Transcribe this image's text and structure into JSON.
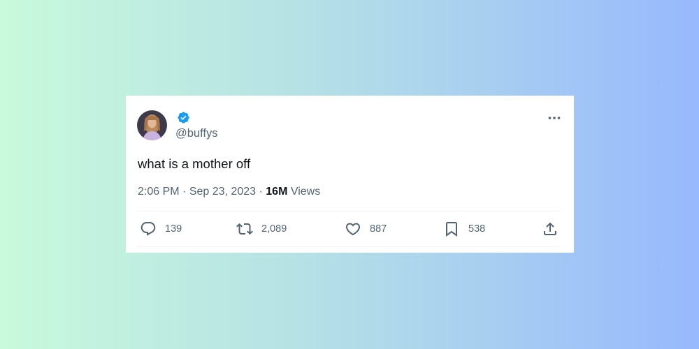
{
  "tweet": {
    "handle": "@buffys",
    "verified": true,
    "verified_color": "#1d9bf0",
    "text": "what is a mother off",
    "time": "2:06 PM",
    "date": "Sep 23, 2023",
    "separator": "·",
    "views_count": "16M",
    "views_label": "Views"
  },
  "actions": {
    "replies": "139",
    "retweets": "2,089",
    "likes": "887",
    "bookmarks": "538"
  },
  "icons": {
    "more": "more-horizontal-icon",
    "reply": "reply-icon",
    "retweet": "retweet-icon",
    "like": "heart-icon",
    "bookmark": "bookmark-icon",
    "share": "share-icon"
  },
  "colors": {
    "text_primary": "#0f1419",
    "text_secondary": "#536471",
    "divider": "#eff3f4"
  }
}
